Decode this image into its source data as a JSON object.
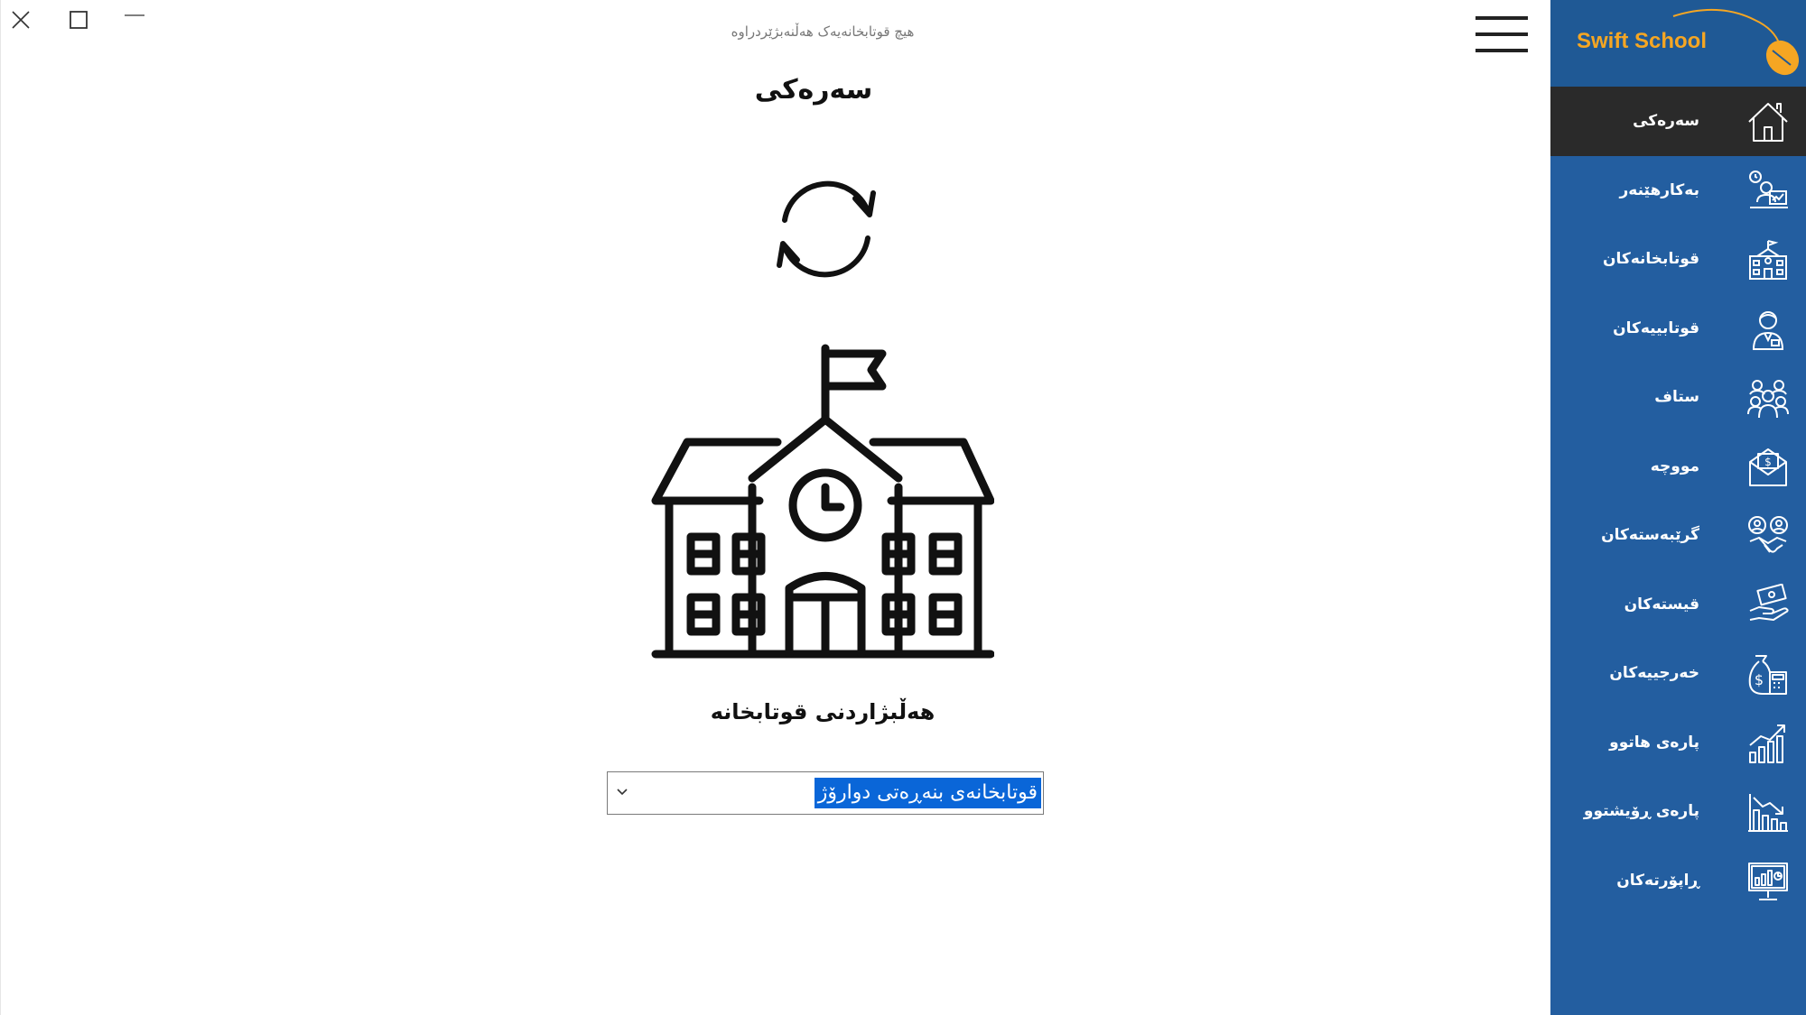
{
  "window": {
    "status_text": "هیچ قوتابخانەیەک هەڵنەبژێردراوە"
  },
  "main": {
    "title": "سەرەکی",
    "select_label": "هەڵبژاردنی قوتابخانە",
    "school_select": {
      "selected_value": "قوتابخانەی بنەڕەتی دوارۆژ"
    }
  },
  "sidebar": {
    "brand": "Swift School",
    "items": [
      {
        "label": "سەرەکی",
        "icon": "home-icon",
        "active": true
      },
      {
        "label": "بەکارهێنەر",
        "icon": "user-admin-icon",
        "active": false
      },
      {
        "label": "قوتابخانەکان",
        "icon": "school-building-icon",
        "active": false
      },
      {
        "label": "قوتابییەکان",
        "icon": "student-icon",
        "active": false
      },
      {
        "label": "ستاف",
        "icon": "staff-group-icon",
        "active": false
      },
      {
        "label": "مووچە",
        "icon": "salary-envelope-icon",
        "active": false
      },
      {
        "label": "گرێبەستەکان",
        "icon": "contract-handshake-icon",
        "active": false
      },
      {
        "label": "قیستەکان",
        "icon": "installment-hand-icon",
        "active": false
      },
      {
        "label": "خەرجییەکان",
        "icon": "expenses-icon",
        "active": false
      },
      {
        "label": "پارەی هاتوو",
        "icon": "income-chart-icon",
        "active": false
      },
      {
        "label": "پارەی ڕۆیشتوو",
        "icon": "outgoing-chart-icon",
        "active": false
      },
      {
        "label": "ڕاپۆرتەکان",
        "icon": "reports-monitor-icon",
        "active": false
      }
    ]
  },
  "colors": {
    "sidebar_bg": "#235ea0",
    "sidebar_active_bg": "#2a2a2a",
    "brand_text": "#f5a623",
    "selection_bg": "#0a66d8"
  }
}
